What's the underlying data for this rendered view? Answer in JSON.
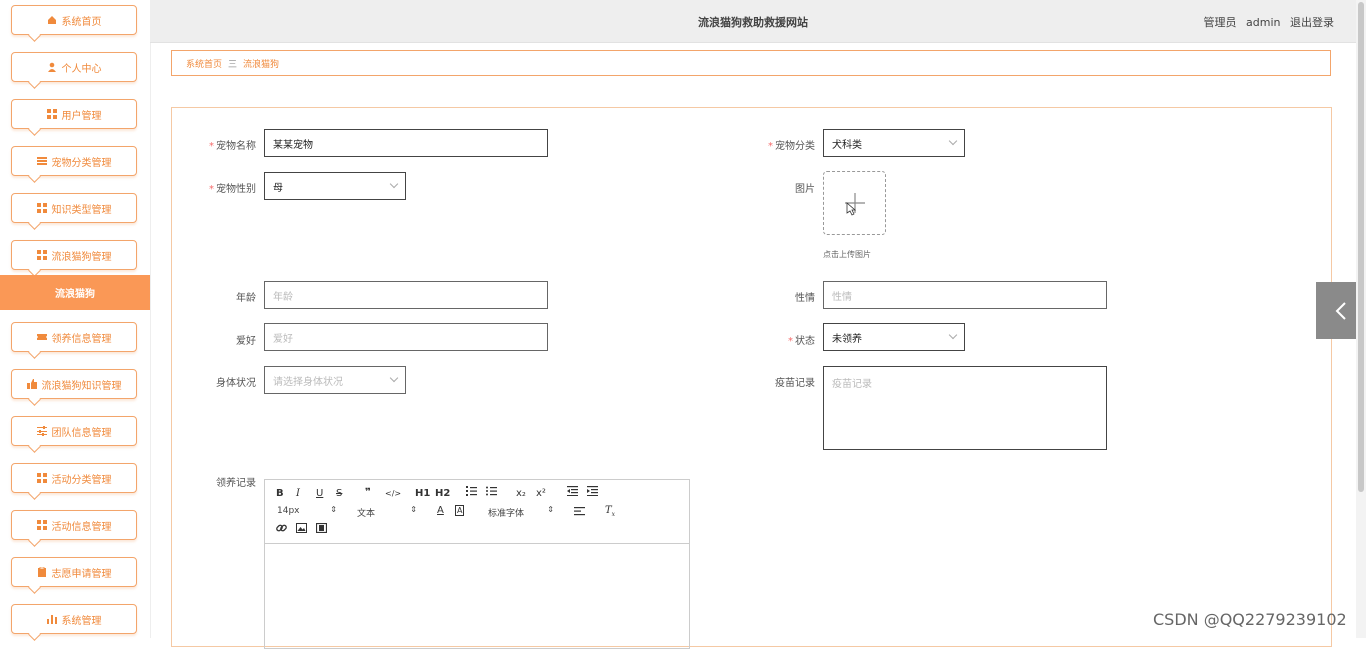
{
  "header": {
    "site_title": "流浪猫狗救助救援网站",
    "user_role": "管理员",
    "username": "admin",
    "logout": "退出登录"
  },
  "sidebar": {
    "items": [
      {
        "label": "系统首页",
        "icon": "home-icon"
      },
      {
        "label": "个人中心",
        "icon": "user-icon"
      },
      {
        "label": "用户管理",
        "icon": "grid-icon"
      },
      {
        "label": "宠物分类管理",
        "icon": "list-icon"
      },
      {
        "label": "知识类型管理",
        "icon": "grid-icon"
      },
      {
        "label": "流浪猫狗管理",
        "icon": "grid-icon"
      }
    ],
    "active": {
      "label": "流浪猫狗"
    },
    "items_after": [
      {
        "label": "领养信息管理",
        "icon": "ticket-icon"
      },
      {
        "label": "流浪猫狗知识管理",
        "icon": "thumb-icon"
      },
      {
        "label": "团队信息管理",
        "icon": "sliders-icon"
      },
      {
        "label": "活动分类管理",
        "icon": "grid-icon"
      },
      {
        "label": "活动信息管理",
        "icon": "grid-icon"
      },
      {
        "label": "志愿申请管理",
        "icon": "clipboard-icon"
      },
      {
        "label": "系统管理",
        "icon": "bar-chart-icon"
      }
    ],
    "accent_color": "#fa9856"
  },
  "breadcrumb": {
    "home": "系统首页",
    "separator": "三",
    "current": "流浪猫狗"
  },
  "form": {
    "pet_name": {
      "label": "宠物名称",
      "value": "某某宠物",
      "required": "*"
    },
    "pet_category": {
      "label": "宠物分类",
      "value": "犬科类",
      "required": "*"
    },
    "pet_gender": {
      "label": "宠物性别",
      "value": "母",
      "required": "*"
    },
    "picture": {
      "label": "图片",
      "tip": "点击上传图片"
    },
    "age": {
      "label": "年龄",
      "placeholder": "年龄"
    },
    "personality": {
      "label": "性情",
      "placeholder": "性情"
    },
    "hobby": {
      "label": "爱好",
      "placeholder": "爱好"
    },
    "status": {
      "label": "状态",
      "value": "未领养",
      "required": "*"
    },
    "health": {
      "label": "身体状况",
      "placeholder": "请选择身体状况"
    },
    "vaccine": {
      "label": "疫苗记录",
      "placeholder": "疫苗记录"
    },
    "adoption_record": {
      "label": "领养记录"
    }
  },
  "editor": {
    "font_size": "14px",
    "text_style": "文本",
    "font_family": "标准字体",
    "buttons": [
      "B",
      "I",
      "U",
      "S",
      "❞",
      "</>",
      "H1",
      "H2",
      "x₂",
      "x²"
    ]
  },
  "watermark": "CSDN @QQ2279239102"
}
